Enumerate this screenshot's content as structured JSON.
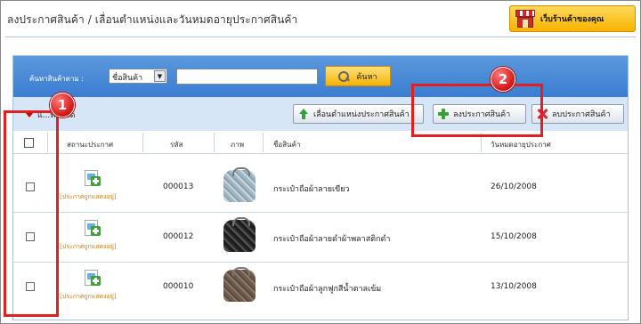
{
  "header": {
    "title": "ลงประกาศสินค้า / เลื่อนตำแหน่งและวันหมดอายุประกาศสินค้า",
    "shop_button_label": "เว็บร้านค้าของคุณ"
  },
  "search": {
    "label": "ค้นหาสินค้าตาม :",
    "field_selected": "ชื่อสินค้า",
    "query_value": "",
    "button_label": "ค้นหา"
  },
  "actions": {
    "select_all_label": "แ...ทั้งหมด",
    "move_label": "เลื่อนตำแหน่งประกาศสินค้า",
    "add_label": "ลงประกาศสินค้า",
    "delete_label": "ลบประกาศสินค้า"
  },
  "table": {
    "columns": [
      "สถานะประกาศ",
      "รหัส",
      "ภาพ",
      "ชื่อสินค้า",
      "วันหมดอายุประกาศ"
    ],
    "rows": [
      {
        "status": "[ประกาศถูกแสดงอยู่]",
        "code": "000013",
        "name": "กระเป๋าถือผ้าลายเขียว",
        "expiry": "26/10/2008",
        "image": "green-pattern-bag"
      },
      {
        "status": "[ประกาศถูกแสดงอยู่]",
        "code": "000012",
        "name": "กระเป๋าถือผ้าลายดำผ้าพลาสติกดำ",
        "expiry": "15/10/2008",
        "image": "black-bag"
      },
      {
        "status": "[ประกาศถูกแสดงอยู่]",
        "code": "000010",
        "name": "กระเป๋าถือผ้าลูกฟูกสีน้ำตาลเข้ม",
        "expiry": "13/10/2008",
        "image": "brown-corduroy-bag"
      }
    ]
  },
  "callouts": [
    "1",
    "2"
  ],
  "colors": {
    "search_bar": "#4a8bd8",
    "action_bar": "#d6e6f7",
    "callout_red": "#e31e1e",
    "status_orange": "#e67a00",
    "shop_button": "#f6b400"
  }
}
